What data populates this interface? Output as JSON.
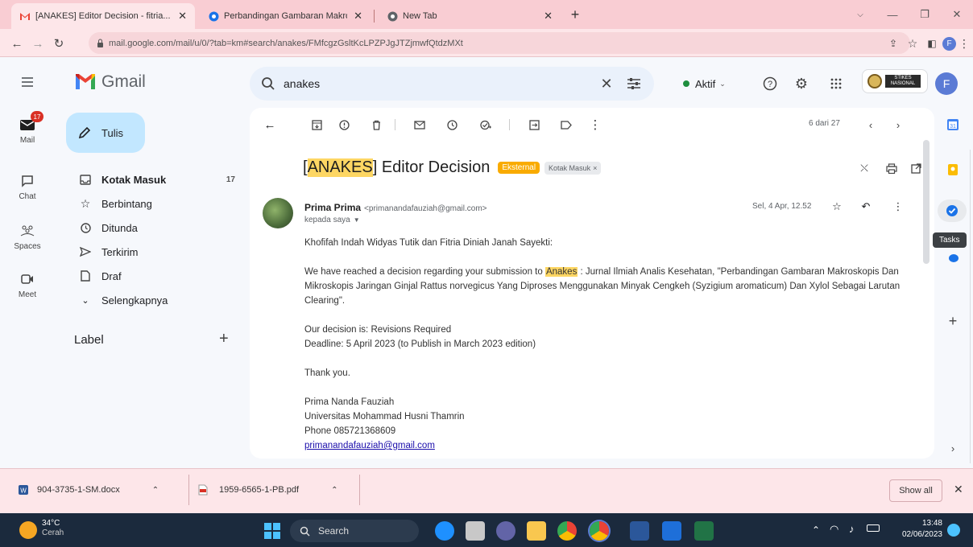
{
  "browser": {
    "tabs": [
      {
        "title": "[ANAKES] Editor Decision - fitria...",
        "active": true
      },
      {
        "title": "Perbandingan Gambaran Makros...",
        "active": false
      },
      {
        "title": "New Tab",
        "active": false
      }
    ],
    "url": "mail.google.com/mail/u/0/?tab=km#search/anakes/FMfcgzGsltKcLPZPJgJTZjmwfQtdzMXt",
    "profile_initial": "F"
  },
  "gmail": {
    "logo_text": "Gmail",
    "search_value": "anakes",
    "status": "Aktif",
    "org_badge": "STIKES NASIONAL",
    "account_initial": "F"
  },
  "rail": {
    "mail_badge": "17",
    "items": [
      {
        "label": "Mail"
      },
      {
        "label": "Chat"
      },
      {
        "label": "Spaces"
      },
      {
        "label": "Meet"
      }
    ]
  },
  "nav": {
    "compose": "Tulis",
    "items": [
      {
        "label": "Kotak Masuk",
        "count": "17"
      },
      {
        "label": "Berbintang",
        "count": ""
      },
      {
        "label": "Ditunda",
        "count": ""
      },
      {
        "label": "Terkirim",
        "count": ""
      },
      {
        "label": "Draf",
        "count": ""
      },
      {
        "label": "Selengkapnya",
        "count": ""
      }
    ],
    "labels_heading": "Label"
  },
  "message": {
    "pagination": "6 dari 27",
    "subject_highlight": "ANAKES",
    "subject_rest": "Editor Decision",
    "label_external": "Eksternal",
    "label_inbox": "Kotak Masuk",
    "sender_name": "Prima Prima",
    "sender_email": "<primanandafauziah@gmail.com>",
    "to_line": "kepada saya",
    "date": "Sel, 4 Apr, 12.52",
    "body": {
      "greeting": "Khofifah Indah Widyas Tutik dan Fitria Diniah Janah Sayekti:",
      "p1_before": "We have reached a decision regarding your submission to ",
      "p1_highlight": "Anakes",
      "p1_after": " : Jurnal Ilmiah Analis Kesehatan, \"Perbandingan Gambaran Makroskopis Dan Mikroskopis Jaringan Ginjal Rattus norvegicus Yang Diproses Menggunakan Minyak Cengkeh (Syzigium aromaticum) Dan Xylol Sebagai Larutan Clearing\".",
      "decision": "Our decision is: Revisions Required",
      "deadline": "Deadline: 5 April 2023 (to Publish in March 2023 edition)",
      "thanks": "Thank you.",
      "sig_name": "Prima Nanda Fauziah",
      "sig_univ": "Universitas Mohammad Husni Thamrin",
      "sig_phone": "Phone 085721368609",
      "sig_email": "primanandafauziah@gmail.com"
    }
  },
  "side_panel": {
    "tooltip": "Tasks"
  },
  "downloads": {
    "items": [
      {
        "name": "904-3735-1-SM.docx",
        "icon": "word-file-icon"
      },
      {
        "name": "1959-6565-1-PB.pdf",
        "icon": "pdf-file-icon"
      }
    ],
    "show_all": "Show all"
  },
  "taskbar": {
    "weather_temp": "34°C",
    "weather_desc": "Cerah",
    "search": "Search",
    "time": "13:48",
    "date": "02/06/2023"
  },
  "colors": {
    "tabstrip": "#f9cdd3",
    "gmail_bg": "#f6f8fc",
    "compose_bg": "#c2e7ff",
    "highlight": "#fdd663",
    "external_label": "#f9ab00",
    "taskbar": "#1b2a3d"
  }
}
